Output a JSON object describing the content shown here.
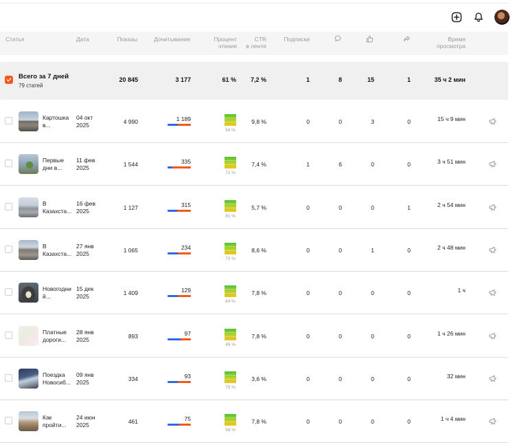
{
  "columns": {
    "article": "Статья",
    "date": "Дата",
    "views": "Показы",
    "reads": "Дочитывания",
    "read_pct_1": "Процент",
    "read_pct_2": "чтения",
    "ctr_1": "CTR",
    "ctr_2": "в ленте",
    "subs": "Подписки",
    "time_1": "Время",
    "time_2": "просмотра"
  },
  "total": {
    "title": "Всего за 7 дней",
    "subtitle": "79 статей",
    "views": "20 845",
    "reads": "3 177",
    "read_pct": "61 %",
    "ctr": "7,2 %",
    "subs": "1",
    "comments": "8",
    "likes": "15",
    "reposts": "1",
    "time": "35 ч 2 мин"
  },
  "rows": [
    {
      "title_1": "Картошка",
      "title_2": "в...",
      "date_1": "04 окт",
      "date_2": "2025",
      "views": "4 990",
      "reads": "1 189",
      "read_fraction": 0.45,
      "read_pct": "54 %",
      "ctr": "9,8 %",
      "subs": "0",
      "comments": "0",
      "likes": "3",
      "reposts": "0",
      "time": "15 ч 9 мин",
      "time_fraction": 0.35,
      "thumb": "road"
    },
    {
      "title_1": "Первые",
      "title_2": "дни в...",
      "date_1": "11 фев",
      "date_2": "2025",
      "views": "1 544",
      "reads": "335",
      "read_fraction": 0.2,
      "read_pct": "71 %",
      "ctr": "7,4 %",
      "subs": "1",
      "comments": "6",
      "likes": "0",
      "reposts": "0",
      "time": "3 ч 51 мин",
      "time_fraction": 0.45,
      "thumb": "tree"
    },
    {
      "title_1": "В",
      "title_2": "Казахста...",
      "date_1": "16 фев",
      "date_2": "2025",
      "views": "1 127",
      "reads": "315",
      "read_fraction": 0.4,
      "read_pct": "81 %",
      "ctr": "5,7 %",
      "subs": "0",
      "comments": "0",
      "likes": "0",
      "reposts": "1",
      "time": "2 ч 54 мин",
      "time_fraction": 0.5,
      "thumb": "city"
    },
    {
      "title_1": "В",
      "title_2": "Казахста...",
      "date_1": "27 янв",
      "date_2": "2025",
      "views": "1 065",
      "reads": "234",
      "read_fraction": 0.45,
      "read_pct": "70 %",
      "ctr": "8,6 %",
      "subs": "0",
      "comments": "0",
      "likes": "1",
      "reposts": "0",
      "time": "2 ч 48 мин",
      "time_fraction": 0.55,
      "thumb": "street"
    },
    {
      "title_1": "Новогодни",
      "title_2": "й...",
      "date_1": "15 дек",
      "date_2": "2025",
      "views": "1 409",
      "reads": "129",
      "read_fraction": 0.45,
      "read_pct": "64 %",
      "ctr": "7,8 %",
      "subs": "0",
      "comments": "0",
      "likes": "0",
      "reposts": "0",
      "time": "1 ч",
      "time_fraction": 0.85,
      "thumb": "tunnel"
    },
    {
      "title_1": "Платные",
      "title_2": "дороги...",
      "date_1": "28 янв",
      "date_2": "2025",
      "views": "893",
      "reads": "97",
      "read_fraction": 0.55,
      "read_pct": "45 %",
      "ctr": "7,8 %",
      "subs": "0",
      "comments": "0",
      "likes": "0",
      "reposts": "0",
      "time": "1 ч 26 мин",
      "time_fraction": 0.5,
      "thumb": "map"
    },
    {
      "title_1": "Поездка",
      "title_2": "Новосиб...",
      "date_1": "09 янв",
      "date_2": "2025",
      "views": "334",
      "reads": "93",
      "read_fraction": 0.45,
      "read_pct": "75 %",
      "ctr": "3,6 %",
      "subs": "0",
      "comments": "0",
      "likes": "0",
      "reposts": "0",
      "time": "32 мин",
      "time_fraction": 0.0,
      "thumb": "mountain"
    },
    {
      "title_1": "Как",
      "title_2": "пройти...",
      "date_1": "24 июн",
      "date_2": "2025",
      "views": "461",
      "reads": "75",
      "read_fraction": 0.5,
      "read_pct": "58 %",
      "ctr": "7,8 %",
      "subs": "0",
      "comments": "0",
      "likes": "0",
      "reposts": "0",
      "time": "1 ч 4 мин",
      "time_fraction": 0.55,
      "thumb": "building"
    }
  ],
  "colors": {
    "accent_orange": "#f25a1c",
    "accent_blue": "#2e6be0",
    "header_bg": "#f5f5f5",
    "total_bg": "#f0f0f0"
  },
  "icons": {
    "top": [
      "add-square-icon",
      "bell-icon",
      "avatar"
    ],
    "columns": [
      "comment-icon",
      "like-icon",
      "repost-icon"
    ],
    "row_action": "megaphone-icon"
  }
}
